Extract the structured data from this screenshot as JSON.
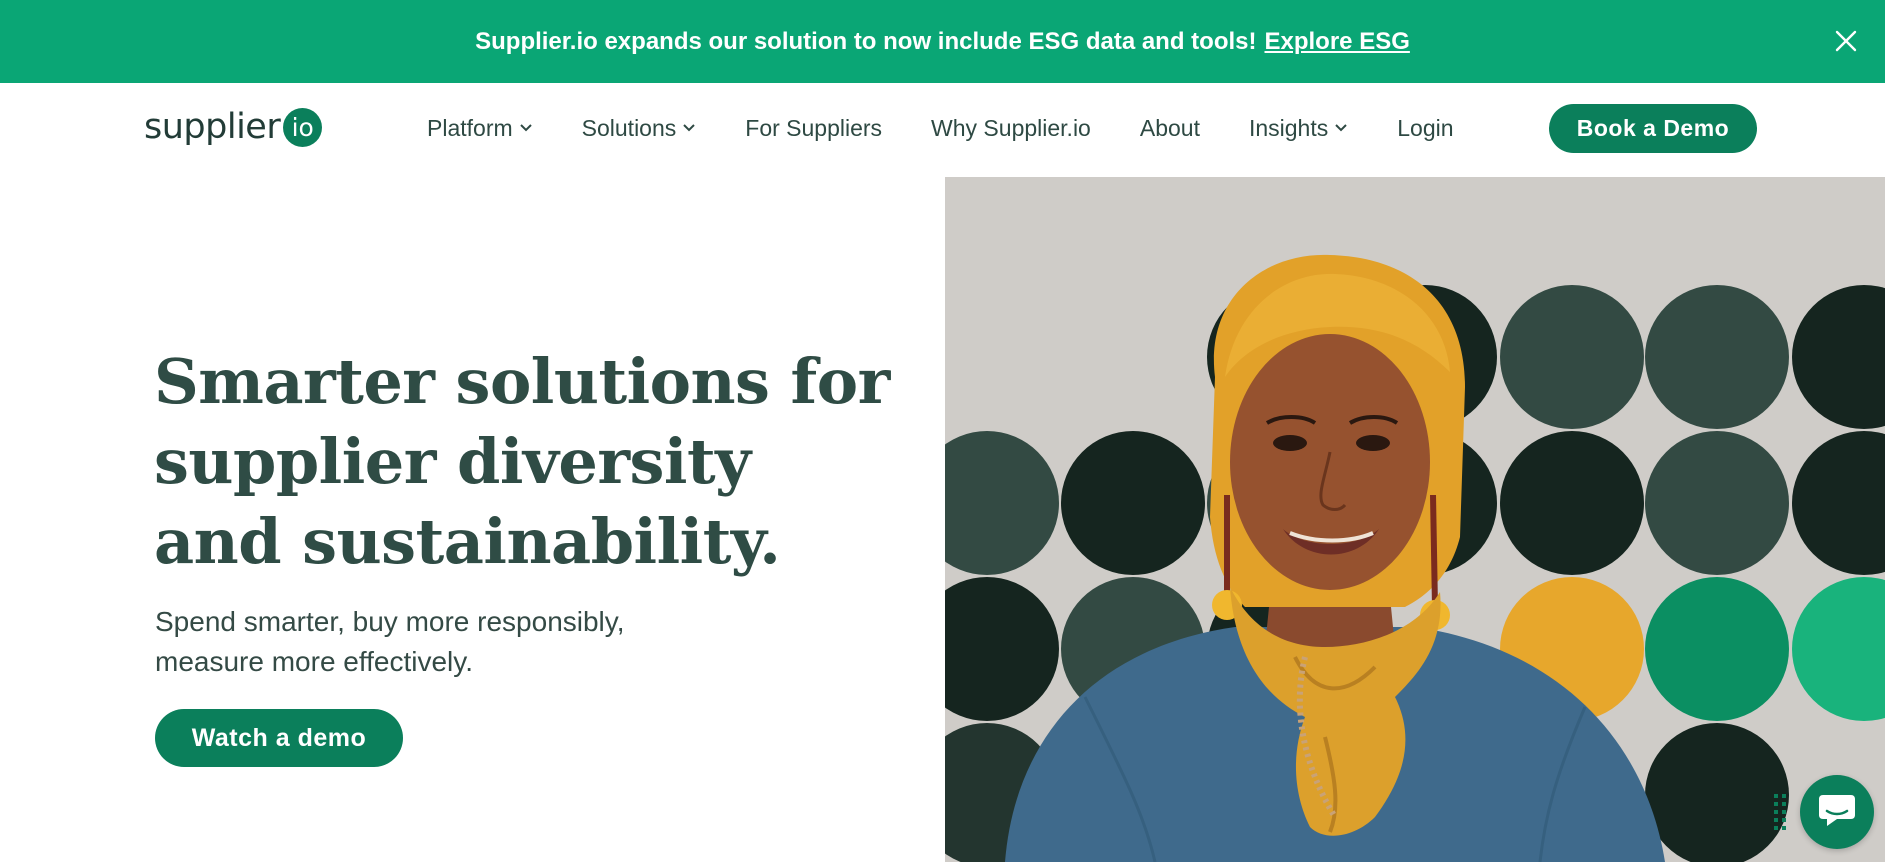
{
  "banner": {
    "message": "Supplier.io expands our solution to now include ESG data and tools!",
    "link_label": "Explore ESG",
    "close_icon": "close-icon",
    "background": "#0aa675"
  },
  "logo": {
    "word": "supplier",
    "badge": "io"
  },
  "nav": {
    "items": [
      {
        "label": "Platform",
        "has_dropdown": true
      },
      {
        "label": "Solutions",
        "has_dropdown": true
      },
      {
        "label": "For Suppliers",
        "has_dropdown": false
      },
      {
        "label": "Why Supplier.io",
        "has_dropdown": false
      },
      {
        "label": "About",
        "has_dropdown": false
      },
      {
        "label": "Insights",
        "has_dropdown": true
      },
      {
        "label": "Login",
        "has_dropdown": false
      }
    ],
    "cta_label": "Book a Demo"
  },
  "hero": {
    "title_lines": [
      "Smarter solutions for",
      "supplier diversity",
      "and sustainability."
    ],
    "subtitle_lines": [
      "Spend smarter, buy more responsibly,",
      "measure more effectively."
    ],
    "button_label": "Watch a demo"
  },
  "colors": {
    "brand_green": "#0b7f5b",
    "heading": "#2f4c45",
    "dot_dark": "#15251f",
    "dot_mid": "#334a43",
    "dot_yellow": "#e7a72c",
    "dot_green": "#0b8f62",
    "dot_bright_green": "#19b37c"
  },
  "chat": {
    "icon": "chat-bubble-icon"
  }
}
